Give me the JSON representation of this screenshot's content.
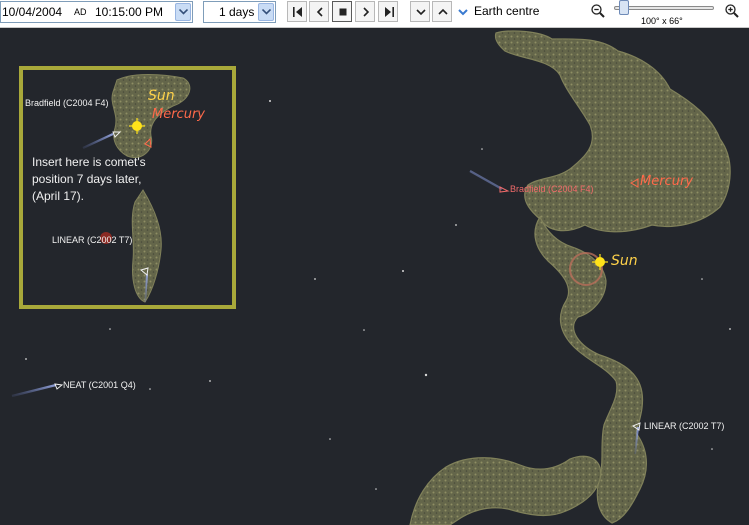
{
  "toolbar": {
    "date": "10/04/2004",
    "era": "AD",
    "time": "10:15:00 PM",
    "step": "1 days",
    "centre_label": "Earth centre",
    "centre_checked": true,
    "zoom_readout": "100° x 66°",
    "zoom_slider_fraction": 0.05,
    "transport_icons": [
      "skip-back-icon",
      "step-back-icon",
      "stop-icon",
      "step-forward-icon",
      "skip-forward-icon"
    ],
    "nav_icons": [
      "chevron-down-icon",
      "chevron-up-icon"
    ]
  },
  "sky": {
    "objects": [
      {
        "name": "Sun",
        "kind": "sun"
      },
      {
        "name": "Mercury",
        "kind": "planet"
      },
      {
        "name": "Bradfield (C2004 F4)",
        "kind": "comet"
      },
      {
        "name": "LINEAR (C2002 T7)",
        "kind": "comet"
      },
      {
        "name": "NEAT (C2001 Q4)",
        "kind": "comet"
      }
    ],
    "inset": {
      "note": "Insert here is comet's position 7 days later, (April 17).",
      "objects": [
        "Bradfield (C2004 F4)",
        "Sun",
        "Mercury",
        "LINEAR (C2002 T7)"
      ]
    }
  },
  "colors": {
    "sky": "#23262c",
    "milky_way": "#8a8a5e",
    "sun": "#ffe21a",
    "planet_label": "#ff6a4a",
    "comet_label_red": "#f06a6a",
    "inset_border": "#a8a83a",
    "comet_tail": "#7a8fd0"
  }
}
